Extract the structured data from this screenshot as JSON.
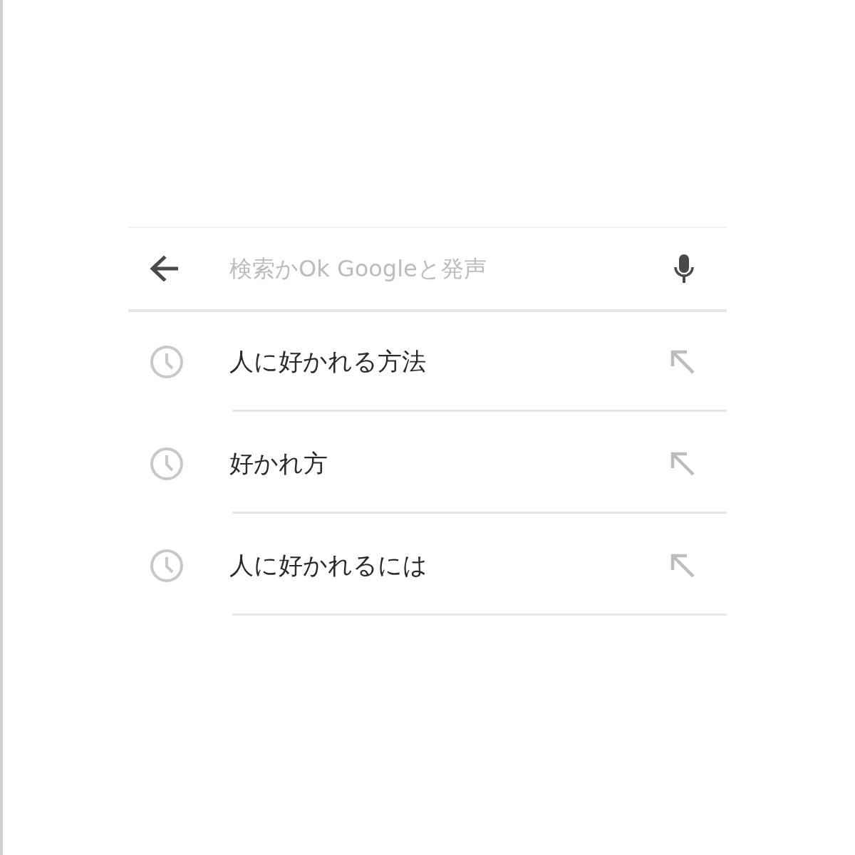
{
  "search_bar": {
    "placeholder": "検索かOk Googleと発声"
  },
  "suggestions": [
    {
      "text": "人に好かれる方法"
    },
    {
      "text": "好かれ方"
    },
    {
      "text": "人に好かれるには"
    }
  ]
}
